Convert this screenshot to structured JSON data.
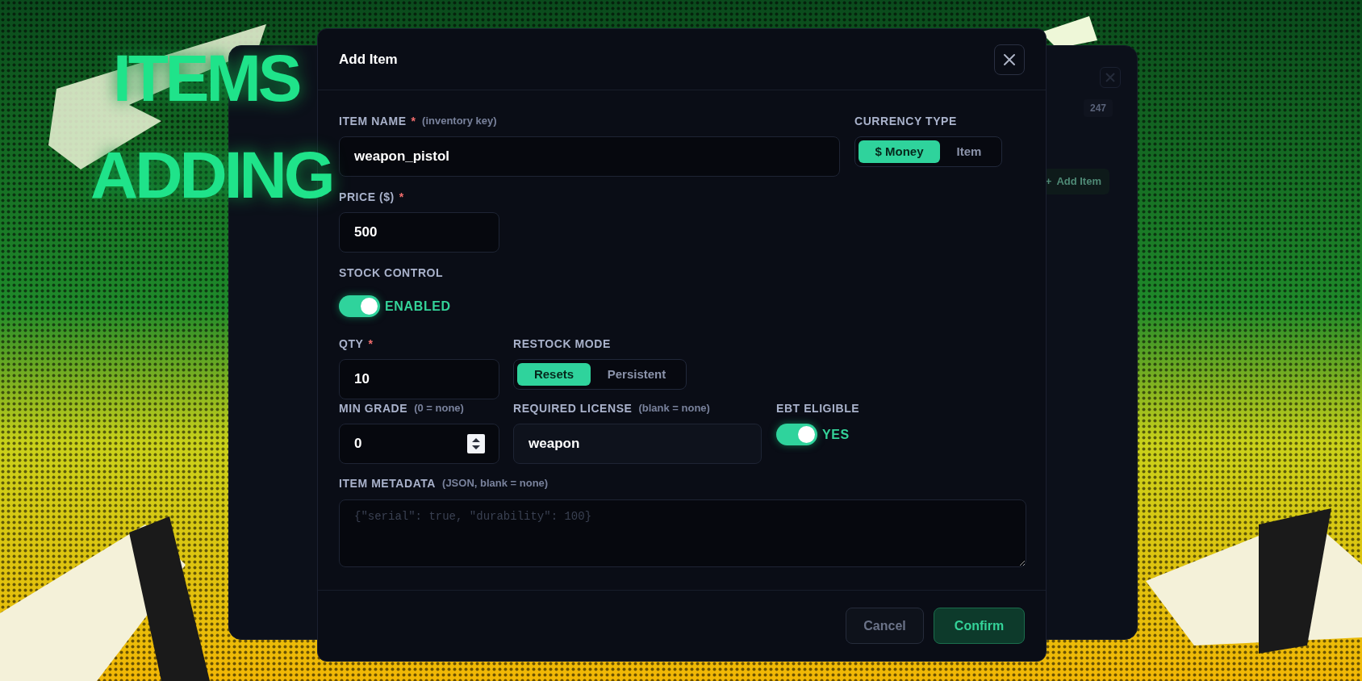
{
  "overlay_title": [
    "ITEMS",
    "ADDING"
  ],
  "background_panel": {
    "badge": "247",
    "add_button": {
      "icon": "+",
      "label": "Add Item"
    }
  },
  "dialog": {
    "title": "Add Item",
    "item_name": {
      "label": "ITEM NAME",
      "required_mark": "*",
      "hint": "(inventory key)",
      "value": "weapon_pistol"
    },
    "currency_type": {
      "label": "CURRENCY TYPE",
      "options": [
        {
          "label": "$ Money",
          "selected": true
        },
        {
          "label": "Item",
          "selected": false
        }
      ]
    },
    "price": {
      "label": "PRICE ($)",
      "required_mark": "*",
      "value": "500"
    },
    "stock_control": {
      "label": "STOCK CONTROL",
      "on": true,
      "state_label": "ENABLED"
    },
    "qty": {
      "label": "QTY",
      "required_mark": "*",
      "value": "10"
    },
    "restock_mode": {
      "label": "RESTOCK MODE",
      "options": [
        {
          "label": "Resets",
          "selected": true
        },
        {
          "label": "Persistent",
          "selected": false
        }
      ]
    },
    "min_grade": {
      "label": "MIN GRADE",
      "hint": "(0 = none)",
      "value": "0"
    },
    "required_license": {
      "label": "REQUIRED LICENSE",
      "hint": "(blank = none)",
      "value": "weapon"
    },
    "ebt_eligible": {
      "label": "EBT ELIGIBLE",
      "on": true,
      "state_label": "YES"
    },
    "item_metadata": {
      "label": "ITEM METADATA",
      "hint": "(JSON, blank = none)",
      "placeholder": "{\"serial\": true, \"durability\": 100}"
    },
    "buttons": [
      {
        "label": "Cancel",
        "kind": "secondary"
      },
      {
        "label": "Confirm",
        "kind": "primary"
      }
    ]
  }
}
